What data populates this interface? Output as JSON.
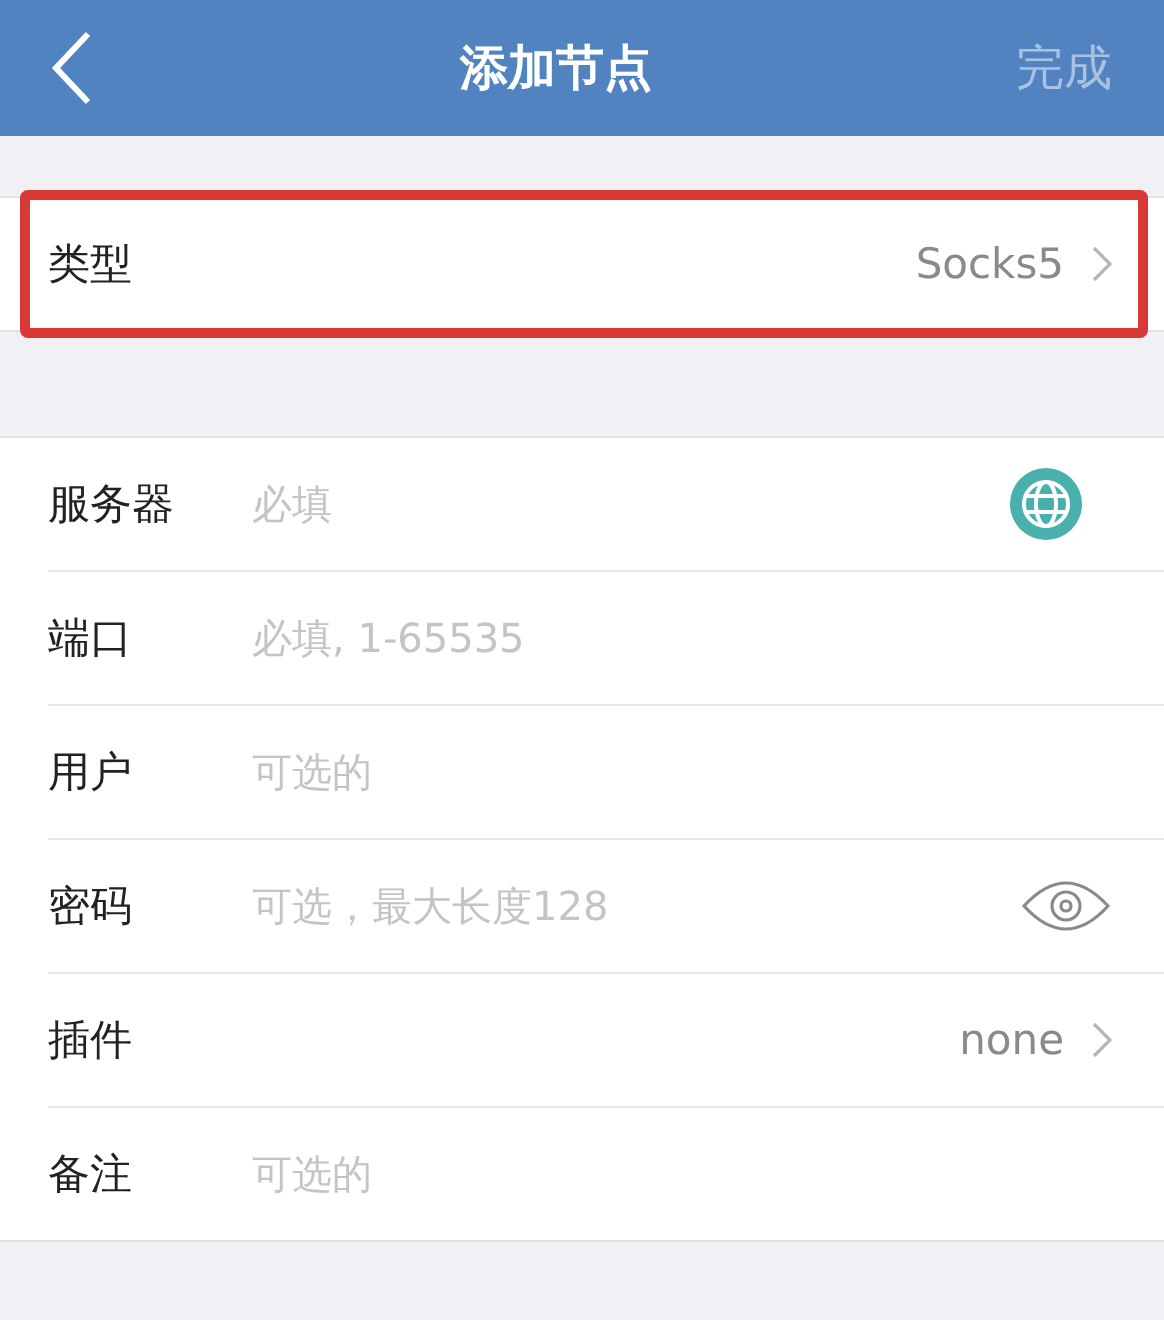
{
  "nav": {
    "title": "添加节点",
    "done": "完成"
  },
  "type_row": {
    "label": "类型",
    "value": "Socks5",
    "highlighted": true
  },
  "fields": [
    {
      "kind": "address",
      "label": "服务器",
      "placeholder": "必填"
    },
    {
      "kind": "input",
      "label": "端口",
      "placeholder": "必填, 1-65535"
    },
    {
      "kind": "input",
      "label": "用户",
      "placeholder": "可选的"
    },
    {
      "kind": "secret",
      "label": "密码",
      "placeholder": "可选，最大长度128"
    },
    {
      "kind": "select",
      "label": "插件",
      "value": "none"
    },
    {
      "kind": "input",
      "label": "备注",
      "placeholder": "可选的"
    }
  ]
}
